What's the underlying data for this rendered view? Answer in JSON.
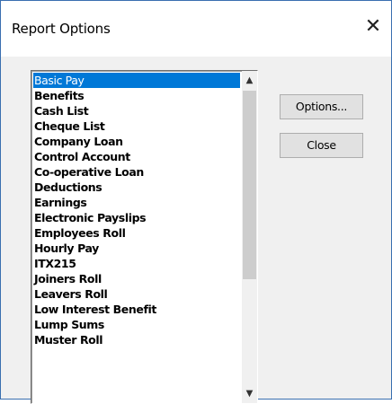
{
  "window": {
    "title": "Report Options",
    "close_glyph": "✕"
  },
  "listbox": {
    "items": [
      {
        "label": "Basic Pay",
        "selected": true
      },
      {
        "label": "Benefits"
      },
      {
        "label": "Cash List"
      },
      {
        "label": "Cheque List"
      },
      {
        "label": "Company Loan"
      },
      {
        "label": "Control Account"
      },
      {
        "label": "Co-operative Loan"
      },
      {
        "label": "Deductions"
      },
      {
        "label": "Earnings"
      },
      {
        "label": "Electronic Payslips"
      },
      {
        "label": "Employees Roll"
      },
      {
        "label": "Hourly Pay"
      },
      {
        "label": "ITX215"
      },
      {
        "label": "Joiners Roll"
      },
      {
        "label": "Leavers Roll"
      },
      {
        "label": "Low Interest Benefit"
      },
      {
        "label": "Lump Sums"
      },
      {
        "label": "Muster Roll"
      }
    ],
    "scroll_up_glyph": "▲",
    "scroll_down_glyph": "▼"
  },
  "buttons": {
    "options_label": "Options...",
    "close_label": "Close"
  },
  "colors": {
    "selection": "#0078d7",
    "window_border": "#3a6fb0",
    "client_bg": "#f0f0f0"
  },
  "icons": {
    "close": "close-icon",
    "scroll_up": "chevron-up-icon",
    "scroll_down": "chevron-down-icon"
  }
}
